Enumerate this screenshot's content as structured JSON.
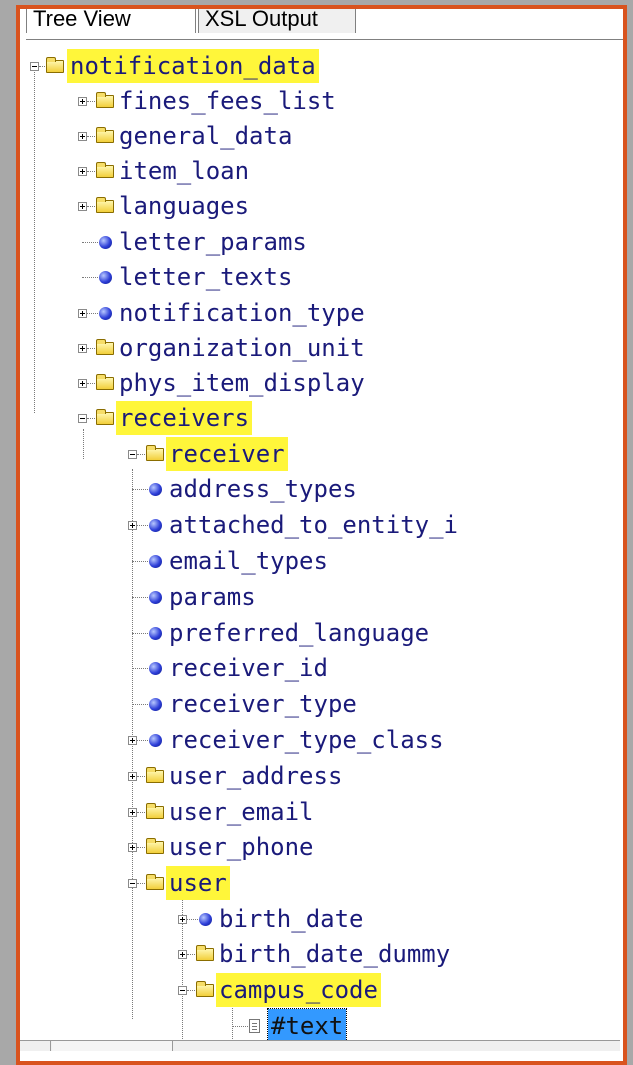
{
  "tabs": [
    "Tree View",
    "XSL Output"
  ],
  "tree": {
    "root": "notification_data",
    "level1": [
      "fines_fees_list",
      "general_data",
      "item_loan",
      "languages",
      "letter_params",
      "letter_texts",
      "notification_type",
      "organization_unit",
      "phys_item_display",
      "receivers"
    ],
    "receiver": "receiver",
    "receiver_children": [
      "address_types",
      "attached_to_entity_i",
      "email_types",
      "params",
      "preferred_language",
      "receiver_id",
      "receiver_type",
      "receiver_type_class",
      "user_address",
      "user_email",
      "user_phone",
      "user"
    ],
    "user_children": [
      "birth_date",
      "birth_date_dummy",
      "campus_code"
    ],
    "campus_children": [
      "#text"
    ]
  },
  "colors": {
    "highlight": "#fff63a",
    "frame": "#d9531e",
    "selection": "#3399ff",
    "text": "#1a1a7a"
  },
  "icons": {
    "folder": "folder-icon",
    "leaf": "element-dot-icon",
    "text": "text-node-icon"
  }
}
